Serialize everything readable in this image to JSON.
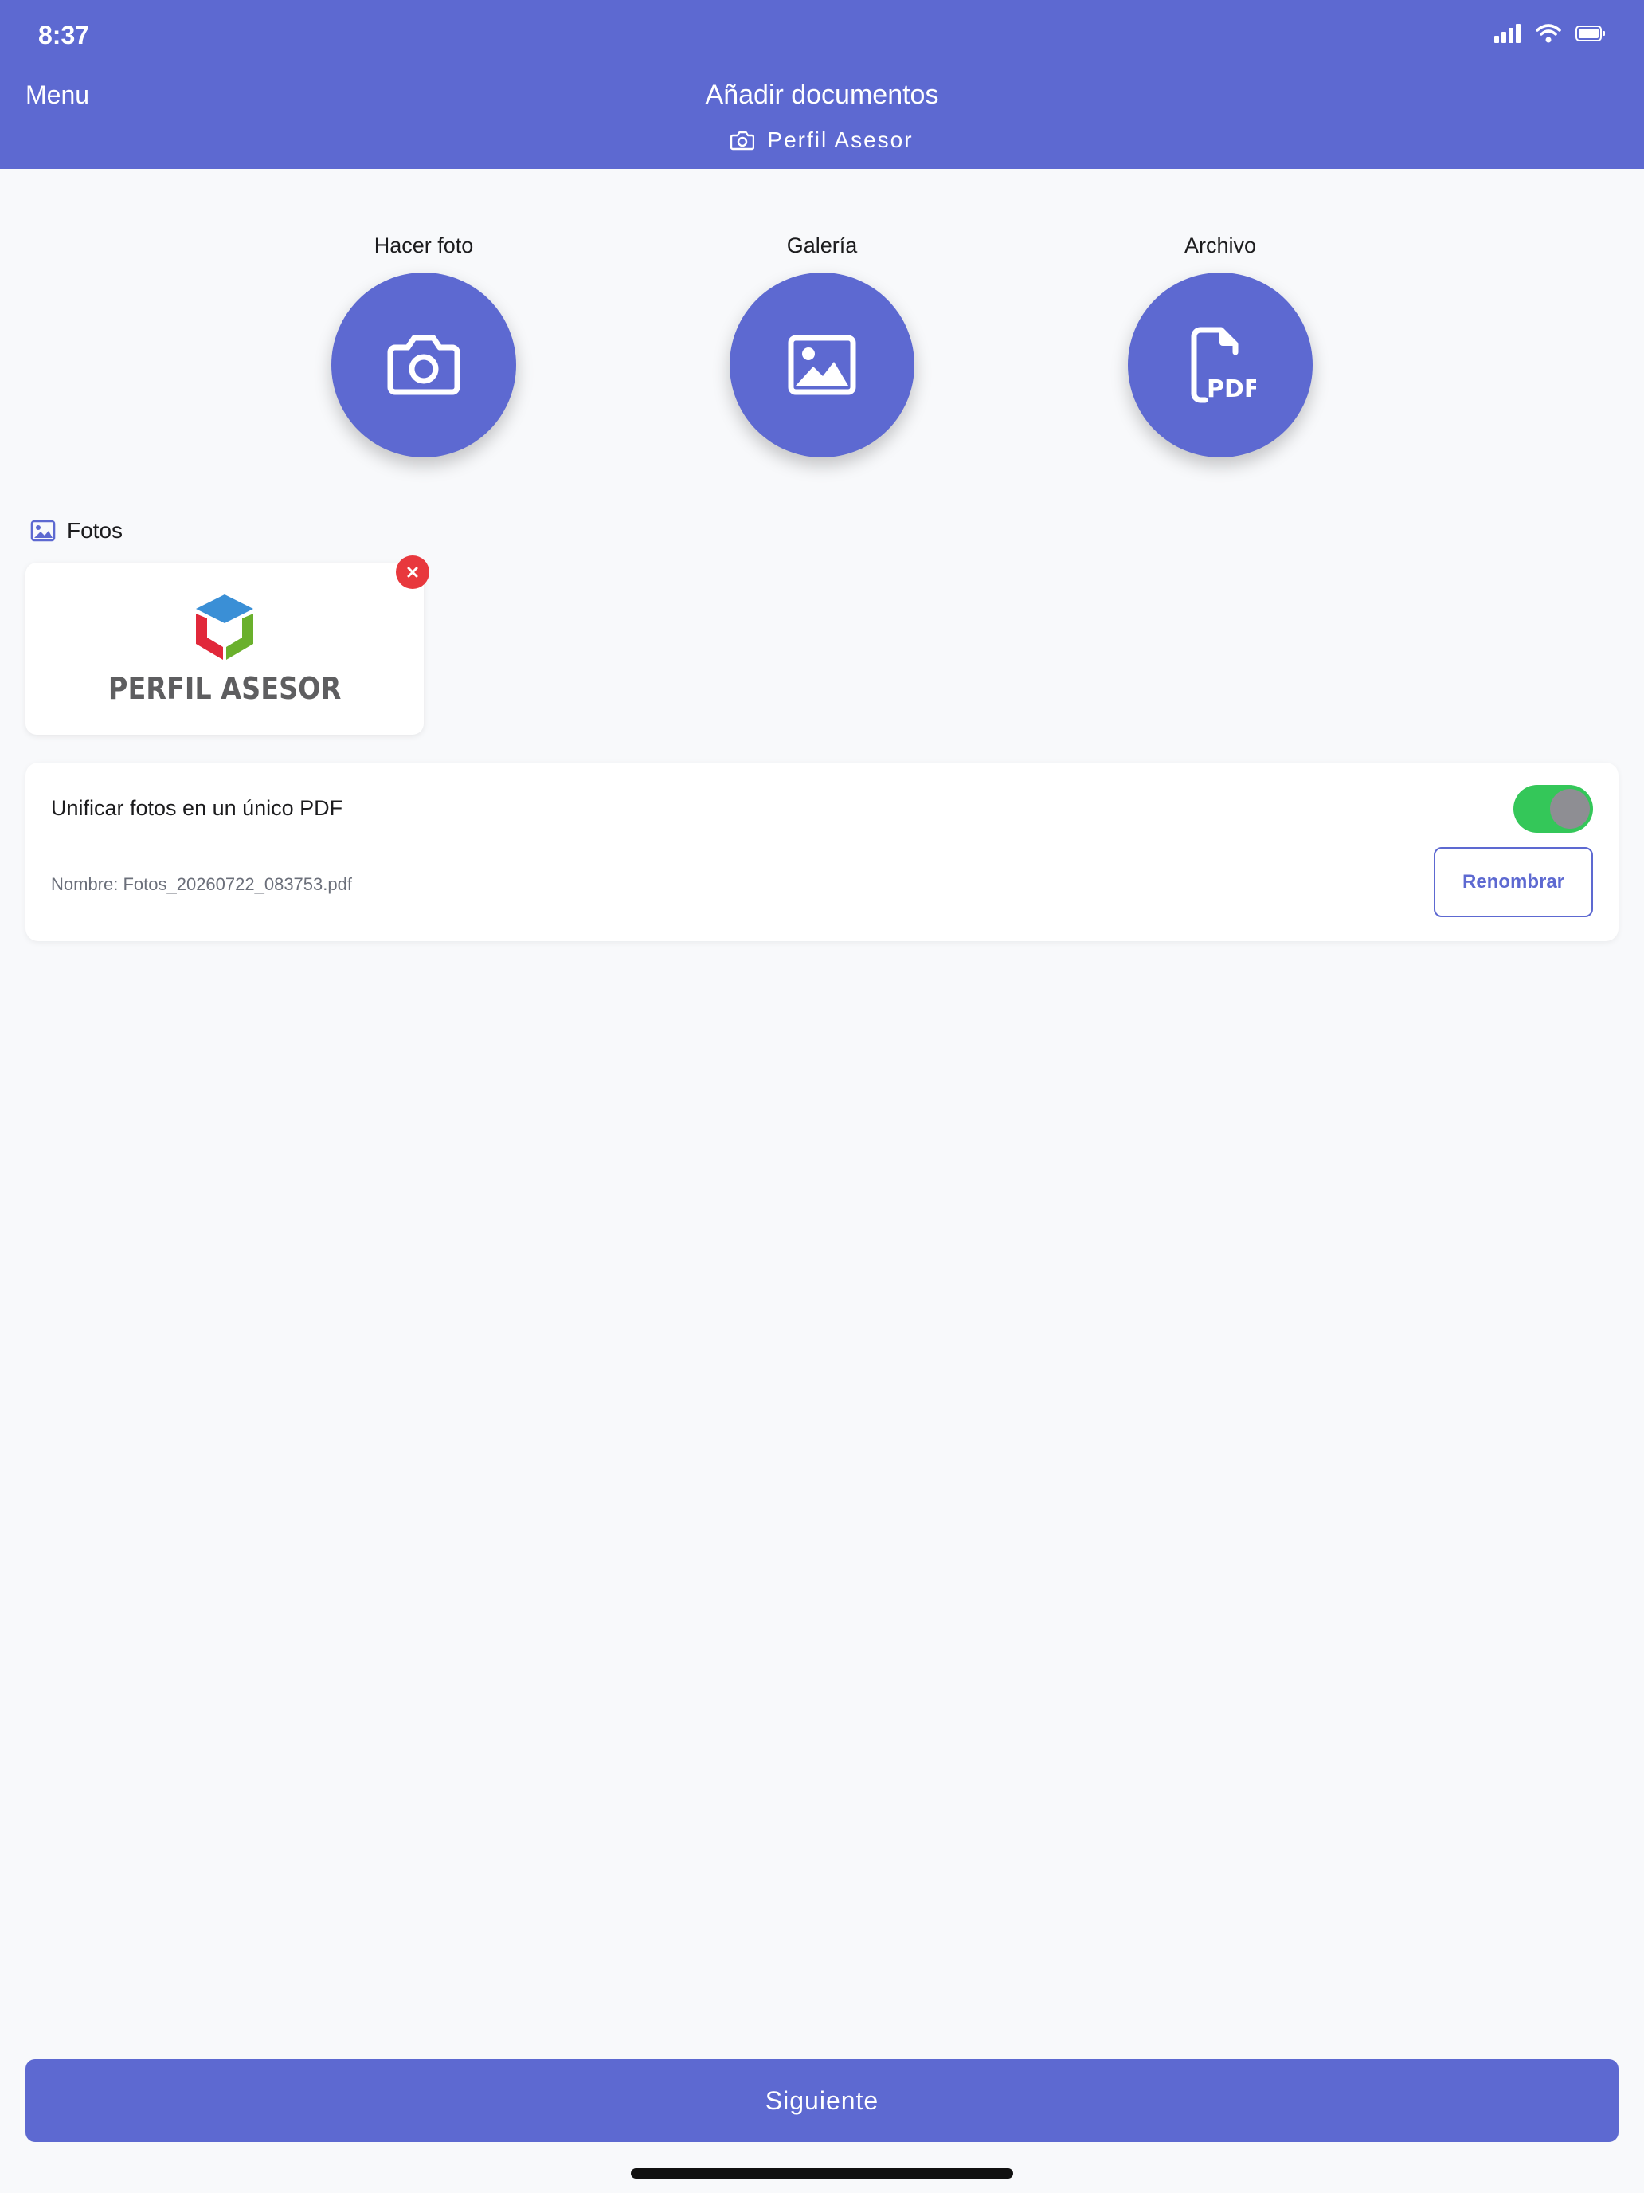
{
  "status_bar": {
    "time": "8:37"
  },
  "header": {
    "menu_label": "Menu",
    "title": "Añadir documentos",
    "subtitle": "Perfil Asesor",
    "background": "#5d69d1"
  },
  "actions": [
    {
      "label": "Hacer foto",
      "icon": "camera-icon"
    },
    {
      "label": "Galería",
      "icon": "image-icon"
    },
    {
      "label": "Archivo",
      "icon": "pdf-file-icon"
    }
  ],
  "photos_section": {
    "title": "Fotos",
    "items": [
      {
        "logo_text": "PERFIL ASESOR"
      }
    ]
  },
  "unify": {
    "label": "Unificar fotos en un único PDF",
    "toggle_on": true,
    "file_name": "Nombre: Fotos_20260722_083753.pdf",
    "rename_label": "Renombrar"
  },
  "footer": {
    "next_label": "Siguiente"
  },
  "colors": {
    "accent": "#5d69d1",
    "toggle_on": "#34c759",
    "delete": "#e8383d"
  }
}
